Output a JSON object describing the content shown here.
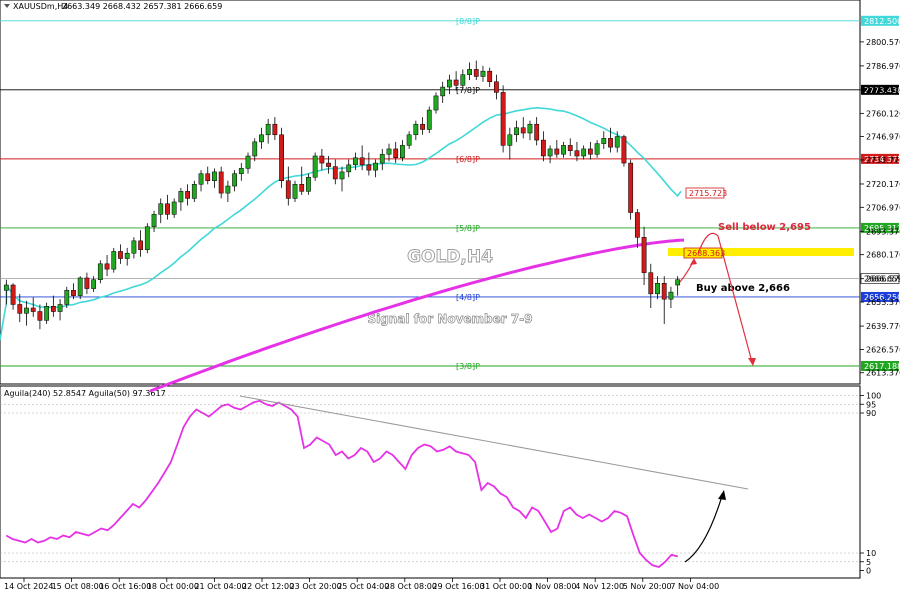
{
  "header": {
    "symbol": "XAUUSDm,H4",
    "ohlc": "2663.349 2668.432 2657.381 2666.659"
  },
  "indicator_header": "Aguila(240) 52.8547  Aguila(50) 97.3617",
  "watermark": "GOLD,H4",
  "signal_text": "Signal for November 7-9",
  "annotations": {
    "sell": "Sell below 2,695",
    "buy": "Buy above 2,666"
  },
  "colors": {
    "bull": "#22a722",
    "bear": "#d11a1a",
    "ma21": "#40d8d8",
    "ma200": "#e632e6",
    "indicator": "#e632e6",
    "highlight": "#ffee00",
    "sell_text": "#e0283c",
    "arrow": "#e03040"
  },
  "chart_data": [
    {
      "type": "candlestick",
      "title": "XAUUSDm,H4",
      "y_ticks": [
        2613.37,
        2626.57,
        2639.77,
        2653.37,
        2666.57,
        2680.17,
        2693.37,
        2706.97,
        2720.17,
        2733.77,
        2746.97,
        2760.12,
        2773.37,
        2786.97,
        2800.57
      ],
      "x_labels": [
        "14 Oct 2024",
        "15 Oct 08:00",
        "16 Oct 16:00",
        "18 Oct 00:00",
        "21 Oct 04:00",
        "22 Oct 12:00",
        "23 Oct 20:00",
        "25 Oct 04:00",
        "28 Oct 08:00",
        "29 Oct 16:00",
        "31 Oct 00:00",
        "1 Nov 08:00",
        "4 Nov 12:00",
        "5 Nov 20:00",
        "7 Nov 04:00"
      ],
      "ylim": [
        2607,
        2822
      ],
      "murrey_levels": [
        {
          "label": "[8/8]P",
          "value": 2812.5,
          "price_tag": "2812.500",
          "color": "#40d8d8"
        },
        {
          "label": "[7/8]P",
          "value": 2773.438,
          "price_tag": "2773.438",
          "color": "#000000"
        },
        {
          "label": "[6/8]P",
          "value": 2734.375,
          "price_tag": "2734.375",
          "color": "#d11a1a"
        },
        {
          "label": "[5/8]P",
          "value": 2695.312,
          "price_tag": "2695.312",
          "color": "#22a722"
        },
        {
          "label": "[4/8]P",
          "value": 2656.25,
          "price_tag": "2656.250",
          "color": "#1e3fd8"
        },
        {
          "label": "[3/8]P",
          "value": 2617.188,
          "price_tag": "2617.188",
          "color": "#22a722"
        }
      ],
      "current_price": 2666.659,
      "ma21_tag": "2715.723",
      "ma200_tag": "2688.363",
      "candles": [
        {
          "o": 2660,
          "h": 2666,
          "l": 2652,
          "c": 2663
        },
        {
          "o": 2663,
          "h": 2664,
          "l": 2649,
          "c": 2652
        },
        {
          "o": 2652,
          "h": 2658,
          "l": 2642,
          "c": 2647
        },
        {
          "o": 2647,
          "h": 2654,
          "l": 2640,
          "c": 2650
        },
        {
          "o": 2650,
          "h": 2656,
          "l": 2645,
          "c": 2648
        },
        {
          "o": 2648,
          "h": 2652,
          "l": 2638,
          "c": 2643
        },
        {
          "o": 2643,
          "h": 2653,
          "l": 2641,
          "c": 2651
        },
        {
          "o": 2651,
          "h": 2657,
          "l": 2645,
          "c": 2648
        },
        {
          "o": 2648,
          "h": 2655,
          "l": 2643,
          "c": 2652
        },
        {
          "o": 2652,
          "h": 2662,
          "l": 2650,
          "c": 2660
        },
        {
          "o": 2660,
          "h": 2664,
          "l": 2655,
          "c": 2657
        },
        {
          "o": 2657,
          "h": 2668,
          "l": 2655,
          "c": 2667
        },
        {
          "o": 2667,
          "h": 2670,
          "l": 2658,
          "c": 2661
        },
        {
          "o": 2661,
          "h": 2668,
          "l": 2659,
          "c": 2666
        },
        {
          "o": 2666,
          "h": 2677,
          "l": 2664,
          "c": 2675
        },
        {
          "o": 2675,
          "h": 2680,
          "l": 2668,
          "c": 2672
        },
        {
          "o": 2672,
          "h": 2684,
          "l": 2670,
          "c": 2682
        },
        {
          "o": 2682,
          "h": 2686,
          "l": 2675,
          "c": 2678
        },
        {
          "o": 2678,
          "h": 2684,
          "l": 2674,
          "c": 2681
        },
        {
          "o": 2681,
          "h": 2690,
          "l": 2678,
          "c": 2688
        },
        {
          "o": 2688,
          "h": 2694,
          "l": 2679,
          "c": 2683
        },
        {
          "o": 2683,
          "h": 2698,
          "l": 2681,
          "c": 2696
        },
        {
          "o": 2696,
          "h": 2705,
          "l": 2693,
          "c": 2703
        },
        {
          "o": 2703,
          "h": 2712,
          "l": 2698,
          "c": 2709
        },
        {
          "o": 2709,
          "h": 2714,
          "l": 2700,
          "c": 2703
        },
        {
          "o": 2703,
          "h": 2712,
          "l": 2701,
          "c": 2710
        },
        {
          "o": 2710,
          "h": 2718,
          "l": 2705,
          "c": 2716
        },
        {
          "o": 2716,
          "h": 2720,
          "l": 2708,
          "c": 2712
        },
        {
          "o": 2712,
          "h": 2722,
          "l": 2710,
          "c": 2720
        },
        {
          "o": 2720,
          "h": 2728,
          "l": 2716,
          "c": 2726
        },
        {
          "o": 2726,
          "h": 2730,
          "l": 2720,
          "c": 2722
        },
        {
          "o": 2722,
          "h": 2729,
          "l": 2718,
          "c": 2727
        },
        {
          "o": 2727,
          "h": 2730,
          "l": 2712,
          "c": 2715
        },
        {
          "o": 2715,
          "h": 2722,
          "l": 2710,
          "c": 2719
        },
        {
          "o": 2719,
          "h": 2728,
          "l": 2716,
          "c": 2726
        },
        {
          "o": 2726,
          "h": 2732,
          "l": 2722,
          "c": 2729
        },
        {
          "o": 2729,
          "h": 2738,
          "l": 2726,
          "c": 2736
        },
        {
          "o": 2736,
          "h": 2746,
          "l": 2733,
          "c": 2744
        },
        {
          "o": 2744,
          "h": 2752,
          "l": 2740,
          "c": 2748
        },
        {
          "o": 2748,
          "h": 2757,
          "l": 2743,
          "c": 2754
        },
        {
          "o": 2754,
          "h": 2758,
          "l": 2745,
          "c": 2748
        },
        {
          "o": 2748,
          "h": 2752,
          "l": 2718,
          "c": 2722
        },
        {
          "o": 2722,
          "h": 2730,
          "l": 2708,
          "c": 2712
        },
        {
          "o": 2712,
          "h": 2722,
          "l": 2710,
          "c": 2720
        },
        {
          "o": 2720,
          "h": 2730,
          "l": 2714,
          "c": 2716
        },
        {
          "o": 2716,
          "h": 2726,
          "l": 2714,
          "c": 2724
        },
        {
          "o": 2724,
          "h": 2738,
          "l": 2722,
          "c": 2736
        },
        {
          "o": 2736,
          "h": 2740,
          "l": 2728,
          "c": 2732
        },
        {
          "o": 2732,
          "h": 2736,
          "l": 2726,
          "c": 2730
        },
        {
          "o": 2730,
          "h": 2734,
          "l": 2720,
          "c": 2723
        },
        {
          "o": 2723,
          "h": 2730,
          "l": 2716,
          "c": 2727
        },
        {
          "o": 2727,
          "h": 2734,
          "l": 2724,
          "c": 2731
        },
        {
          "o": 2731,
          "h": 2738,
          "l": 2728,
          "c": 2735
        },
        {
          "o": 2735,
          "h": 2742,
          "l": 2728,
          "c": 2731
        },
        {
          "o": 2731,
          "h": 2738,
          "l": 2725,
          "c": 2728
        },
        {
          "o": 2728,
          "h": 2734,
          "l": 2724,
          "c": 2732
        },
        {
          "o": 2732,
          "h": 2740,
          "l": 2728,
          "c": 2737
        },
        {
          "o": 2737,
          "h": 2743,
          "l": 2733,
          "c": 2740
        },
        {
          "o": 2740,
          "h": 2744,
          "l": 2732,
          "c": 2735
        },
        {
          "o": 2735,
          "h": 2745,
          "l": 2733,
          "c": 2742
        },
        {
          "o": 2742,
          "h": 2750,
          "l": 2740,
          "c": 2748
        },
        {
          "o": 2748,
          "h": 2756,
          "l": 2745,
          "c": 2754
        },
        {
          "o": 2754,
          "h": 2758,
          "l": 2748,
          "c": 2751
        },
        {
          "o": 2751,
          "h": 2764,
          "l": 2749,
          "c": 2762
        },
        {
          "o": 2762,
          "h": 2772,
          "l": 2760,
          "c": 2770
        },
        {
          "o": 2770,
          "h": 2778,
          "l": 2766,
          "c": 2775
        },
        {
          "o": 2775,
          "h": 2782,
          "l": 2771,
          "c": 2779
        },
        {
          "o": 2779,
          "h": 2784,
          "l": 2773,
          "c": 2776
        },
        {
          "o": 2776,
          "h": 2785,
          "l": 2774,
          "c": 2782
        },
        {
          "o": 2782,
          "h": 2789,
          "l": 2779,
          "c": 2785
        },
        {
          "o": 2785,
          "h": 2790,
          "l": 2779,
          "c": 2781
        },
        {
          "o": 2781,
          "h": 2787,
          "l": 2778,
          "c": 2784
        },
        {
          "o": 2784,
          "h": 2786,
          "l": 2775,
          "c": 2778
        },
        {
          "o": 2778,
          "h": 2782,
          "l": 2768,
          "c": 2772
        },
        {
          "o": 2772,
          "h": 2776,
          "l": 2738,
          "c": 2742
        },
        {
          "o": 2742,
          "h": 2752,
          "l": 2734,
          "c": 2748
        },
        {
          "o": 2748,
          "h": 2756,
          "l": 2744,
          "c": 2752
        },
        {
          "o": 2752,
          "h": 2758,
          "l": 2746,
          "c": 2749
        },
        {
          "o": 2749,
          "h": 2756,
          "l": 2745,
          "c": 2754
        },
        {
          "o": 2754,
          "h": 2758,
          "l": 2742,
          "c": 2745
        },
        {
          "o": 2745,
          "h": 2750,
          "l": 2733,
          "c": 2736
        },
        {
          "o": 2736,
          "h": 2742,
          "l": 2732,
          "c": 2740
        },
        {
          "o": 2740,
          "h": 2745,
          "l": 2735,
          "c": 2737
        },
        {
          "o": 2737,
          "h": 2744,
          "l": 2735,
          "c": 2742
        },
        {
          "o": 2742,
          "h": 2746,
          "l": 2736,
          "c": 2739
        },
        {
          "o": 2739,
          "h": 2744,
          "l": 2733,
          "c": 2736
        },
        {
          "o": 2736,
          "h": 2742,
          "l": 2734,
          "c": 2740
        },
        {
          "o": 2740,
          "h": 2744,
          "l": 2734,
          "c": 2737
        },
        {
          "o": 2737,
          "h": 2745,
          "l": 2735,
          "c": 2743
        },
        {
          "o": 2743,
          "h": 2750,
          "l": 2740,
          "c": 2746
        },
        {
          "o": 2746,
          "h": 2752,
          "l": 2738,
          "c": 2741
        },
        {
          "o": 2741,
          "h": 2750,
          "l": 2738,
          "c": 2747
        },
        {
          "o": 2747,
          "h": 2748,
          "l": 2730,
          "c": 2732
        },
        {
          "o": 2732,
          "h": 2734,
          "l": 2700,
          "c": 2704
        },
        {
          "o": 2704,
          "h": 2706,
          "l": 2684,
          "c": 2690
        },
        {
          "o": 2690,
          "h": 2696,
          "l": 2663,
          "c": 2670
        },
        {
          "o": 2670,
          "h": 2675,
          "l": 2650,
          "c": 2658
        },
        {
          "o": 2658,
          "h": 2668,
          "l": 2655,
          "c": 2664
        },
        {
          "o": 2664,
          "h": 2668,
          "l": 2641,
          "c": 2655
        },
        {
          "o": 2655,
          "h": 2662,
          "l": 2650,
          "c": 2659
        },
        {
          "o": 2663,
          "h": 2668,
          "l": 2657,
          "c": 2666
        }
      ]
    },
    {
      "type": "line",
      "title": "Aguila(240) 52.8547  Aguila(50) 97.3617",
      "y_ticks": [
        100,
        95,
        90,
        10,
        5,
        0
      ],
      "ylim": [
        -2,
        102
      ],
      "series": [
        {
          "name": "Aguila(240)",
          "values": [
            20,
            18,
            17,
            16,
            18,
            16,
            17,
            19,
            18,
            20,
            19,
            22,
            21,
            20,
            22,
            24,
            23,
            26,
            30,
            34,
            38,
            36,
            40,
            45,
            50,
            56,
            62,
            72,
            82,
            88,
            92,
            90,
            88,
            91,
            94,
            95,
            93,
            92,
            94,
            96,
            97,
            95,
            94,
            96,
            94,
            92,
            88,
            70,
            72,
            76,
            74,
            72,
            66,
            68,
            64,
            66,
            70,
            68,
            62,
            64,
            68,
            66,
            62,
            58,
            66,
            70,
            72,
            71,
            68,
            69,
            71,
            68,
            67,
            66,
            62,
            46,
            50,
            48,
            44,
            42,
            36,
            34,
            30,
            36,
            34,
            28,
            22,
            24,
            34,
            36,
            32,
            30,
            32,
            30,
            28,
            30,
            34,
            33,
            31,
            20,
            10,
            6,
            3,
            2,
            5,
            9,
            8
          ]
        }
      ],
      "levels": [
        90,
        95,
        100,
        10,
        5
      ]
    }
  ]
}
